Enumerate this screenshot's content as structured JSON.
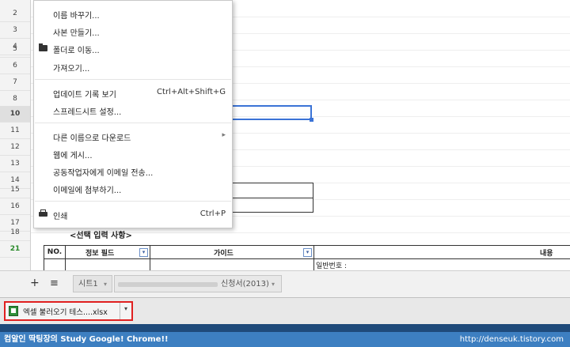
{
  "row_numbers": [
    "2",
    "3",
    "4",
    "5",
    "6",
    "7",
    "8",
    "9",
    "10",
    "11",
    "12",
    "13",
    "14",
    "15",
    "16",
    "17",
    "18",
    "19",
    "21"
  ],
  "menu": {
    "items": [
      {
        "label": "이름 바꾸기..."
      },
      {
        "label": "사본 만들기..."
      },
      {
        "label": "폴더로 이동..."
      },
      {
        "label": "가져오기..."
      },
      {
        "label": "업데이트 기록 보기",
        "shortcut": "Ctrl+Alt+Shift+G"
      },
      {
        "label": "스프레드시트 설정..."
      },
      {
        "label": "다른 이름으로 다운로드",
        "arrow": "▸"
      },
      {
        "label": "웹에 게시..."
      },
      {
        "label": "공동작업자에게 이메일 전송..."
      },
      {
        "label": "이메일에 첨부하기..."
      },
      {
        "label": "인쇄",
        "shortcut": "Ctrl+P"
      }
    ]
  },
  "sheet": {
    "section_title": "<선택 입력 사항>",
    "col_no": "NO.",
    "col_info": "정보 필드",
    "col_guide": "가이드",
    "col_content": "내용",
    "cell_value": "일반번호 :"
  },
  "tabs": {
    "add_icon": "+",
    "list_icon": "≡",
    "tab1": "시트1",
    "tab2": "신청서(2013)",
    "dropdown_icon": "▾"
  },
  "download": {
    "filename": "엑셀 불러오기 테스....xlsx",
    "caret": "▾"
  },
  "footer": {
    "left": "컴알인 딱팅장의 Study Google! Chrome!!",
    "right": "http://denseuk.tistory.com"
  },
  "colors": {
    "selection_border": "#3b73d6",
    "highlight_border": "#e02020",
    "green": "#2a8a2a",
    "footer_bg": "#3d7fc1"
  }
}
